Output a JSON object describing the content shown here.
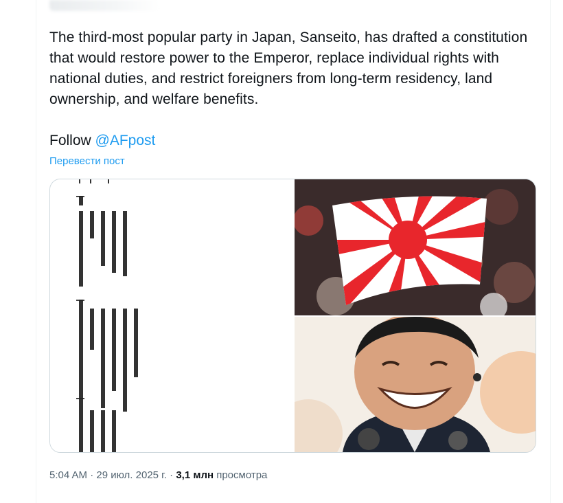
{
  "tweet": {
    "text": "The third-most popular party in Japan, Sanseito, has drafted a constitution that would restore power to the Emperor, replace individual rights with national duties, and restrict foreigners from long-term residency, land ownership, and welfare benefits.",
    "follow_word": "Follow",
    "mention": "@AFpost",
    "translate_label": "Перевести пост"
  },
  "media": {
    "images": [
      {
        "name": "japanese-constitution-draft-document"
      },
      {
        "name": "rising-sun-flag-crowd-photo"
      },
      {
        "name": "smiling-man-photo"
      }
    ]
  },
  "meta": {
    "time": "5:04 AM",
    "sep1": " · ",
    "date": "29 июл. 2025 г.",
    "sep2": " · ",
    "views_count": "3,1 млн",
    "views_label": " просмотра"
  },
  "colors": {
    "accent": "#1d9bf0",
    "text": "#0f1419",
    "secondary": "#536471",
    "border": "#cfd9de",
    "flag_red": "#e8262c"
  }
}
